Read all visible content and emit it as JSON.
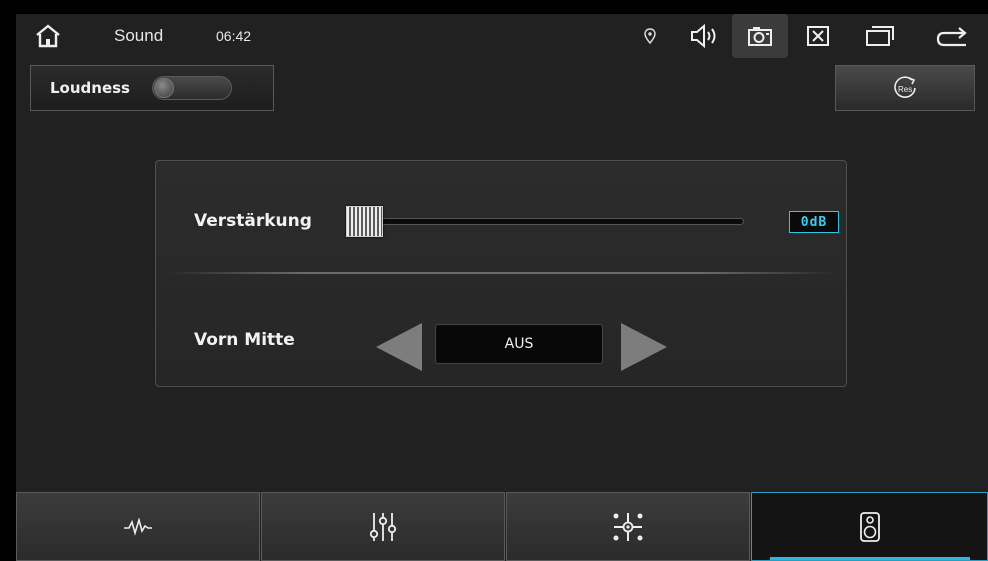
{
  "status_bar": {
    "title": "Sound",
    "time": "06:42",
    "icons": [
      "home-icon",
      "location-icon",
      "volume-icon",
      "camera-icon",
      "close-box-icon",
      "window-icon",
      "back-icon"
    ]
  },
  "loudness": {
    "label": "Loudness",
    "enabled": false
  },
  "reset_button": {
    "icon": "reset-icon",
    "icon_text": "Res"
  },
  "gain": {
    "label": "Verstärkung",
    "value_text": "0dB",
    "level": 0
  },
  "front_center": {
    "label": "Vorn Mitte",
    "value": "AUS"
  },
  "tabs": [
    {
      "icon": "pulse-icon",
      "active": false
    },
    {
      "icon": "equalizer-icon",
      "active": false
    },
    {
      "icon": "balance-icon",
      "active": false
    },
    {
      "icon": "speaker-icon",
      "active": true
    }
  ],
  "colors": {
    "accent": "#35d0f2",
    "background": "#212121"
  }
}
